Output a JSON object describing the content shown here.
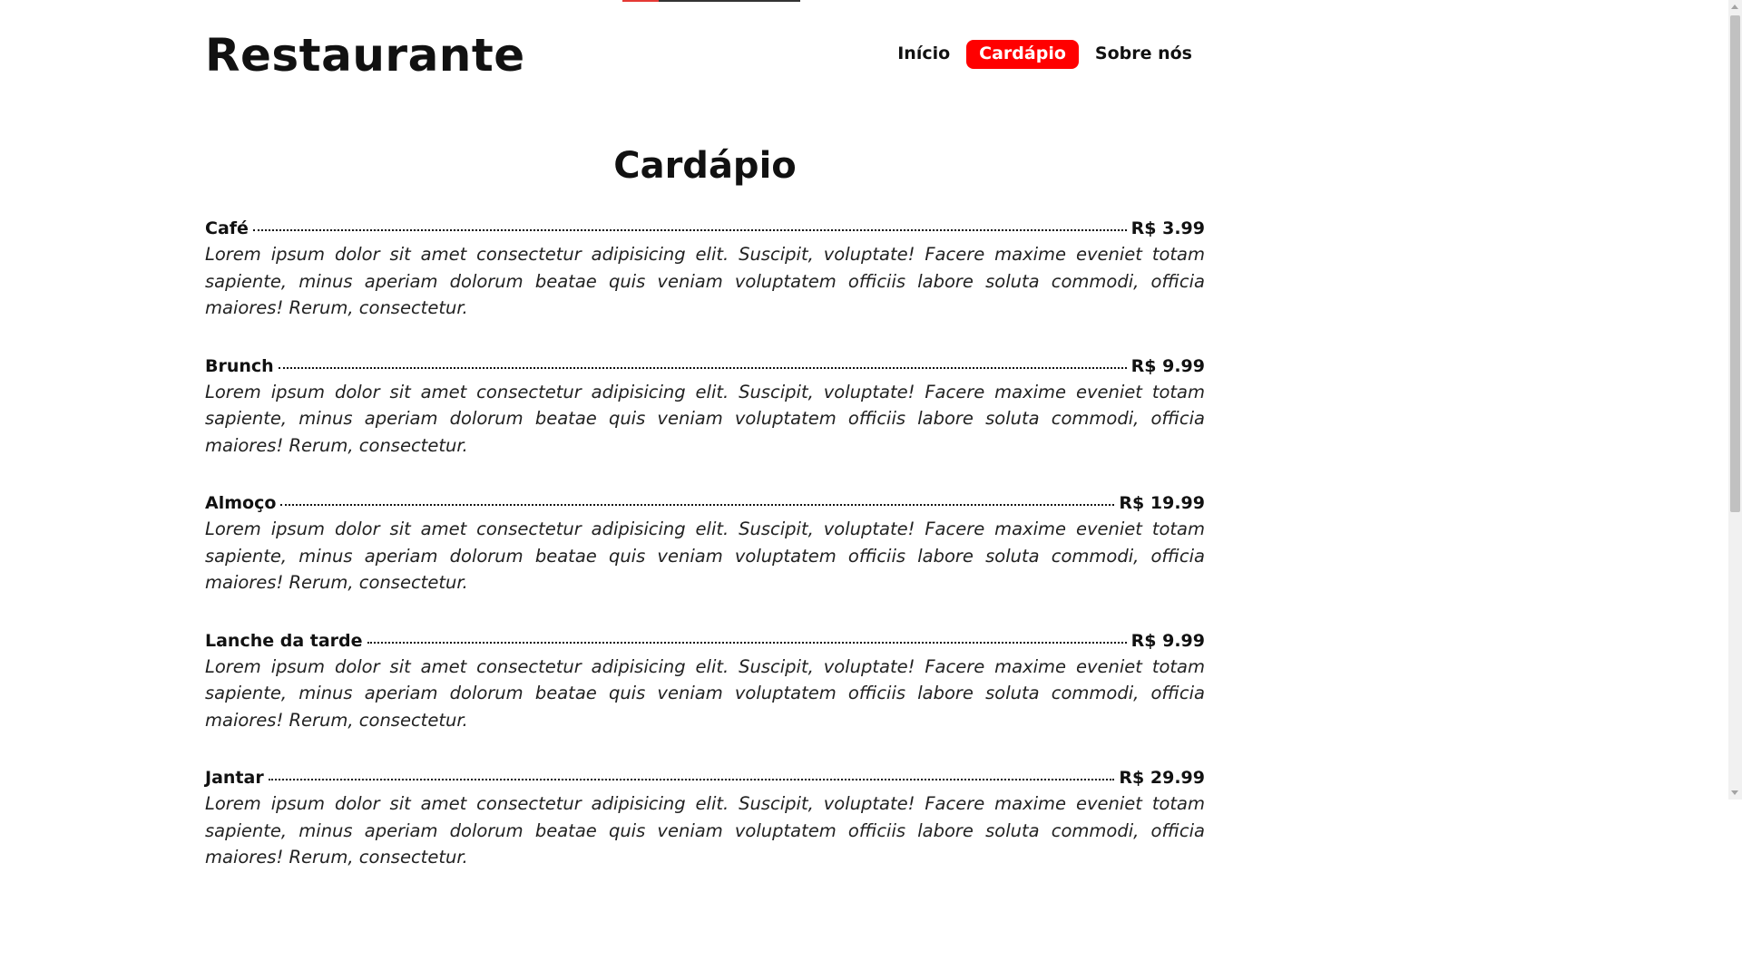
{
  "header": {
    "brand": "Restaurante",
    "nav": [
      {
        "label": "Início",
        "active": false
      },
      {
        "label": "Cardápio",
        "active": true
      },
      {
        "label": "Sobre nós",
        "active": false
      }
    ]
  },
  "main": {
    "title": "Cardápio",
    "items": [
      {
        "name": "Café",
        "price": "R$ 3.99",
        "description": "Lorem ipsum dolor sit amet consectetur adipisicing elit. Suscipit, voluptate! Facere maxime eveniet totam sapiente, minus aperiam dolorum beatae quis veniam voluptatem officiis labore soluta commodi, officia maiores! Rerum, consectetur."
      },
      {
        "name": "Brunch",
        "price": "R$ 9.99",
        "description": "Lorem ipsum dolor sit amet consectetur adipisicing elit. Suscipit, voluptate! Facere maxime eveniet totam sapiente, minus aperiam dolorum beatae quis veniam voluptatem officiis labore soluta commodi, officia maiores! Rerum, consectetur."
      },
      {
        "name": "Almoço",
        "price": "R$ 19.99",
        "description": "Lorem ipsum dolor sit amet consectetur adipisicing elit. Suscipit, voluptate! Facere maxime eveniet totam sapiente, minus aperiam dolorum beatae quis veniam voluptatem officiis labore soluta commodi, officia maiores! Rerum, consectetur."
      },
      {
        "name": "Lanche da tarde",
        "price": "R$ 9.99",
        "description": "Lorem ipsum dolor sit amet consectetur adipisicing elit. Suscipit, voluptate! Facere maxime eveniet totam sapiente, minus aperiam dolorum beatae quis veniam voluptatem officiis labore soluta commodi, officia maiores! Rerum, consectetur."
      },
      {
        "name": "Jantar",
        "price": "R$ 29.99",
        "description": "Lorem ipsum dolor sit amet consectetur adipisicing elit. Suscipit, voluptate! Facere maxime eveniet totam sapiente, minus aperiam dolorum beatae quis veniam voluptatem officiis labore soluta commodi, officia maiores! Rerum, consectetur."
      }
    ]
  },
  "colors": {
    "accent": "#ff0000",
    "text": "#111111",
    "background": "#ffffff"
  }
}
